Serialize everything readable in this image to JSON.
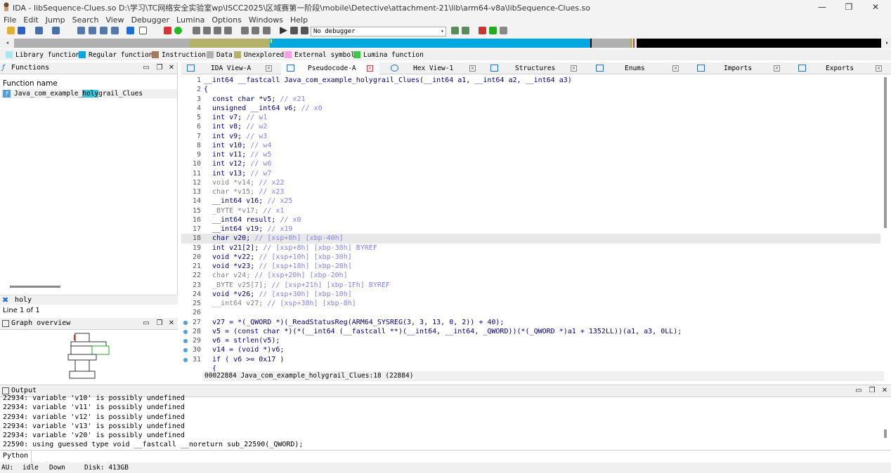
{
  "window": {
    "title": "IDA - libSequence-Clues.so D:\\学习\\TC网络安全实验室wp\\ISCC2025\\区域赛第一阶段\\mobile\\Detective\\attachment-21\\lib\\arm64-v8a\\libSequence-Clues.so",
    "minimize": "—",
    "maximize": "❐",
    "close": "✕"
  },
  "menu": [
    "File",
    "Edit",
    "Jump",
    "Search",
    "View",
    "Debugger",
    "Lumina",
    "Options",
    "Windows",
    "Help"
  ],
  "toolbar": {
    "debugger_select": "No debugger"
  },
  "legend": [
    {
      "label": "Library function",
      "color": "#a8e6f0"
    },
    {
      "label": "Regular function",
      "color": "#00a8e0"
    },
    {
      "label": "Instruction",
      "color": "#a67b5b"
    },
    {
      "label": "Data",
      "color": "#b0b0b0"
    },
    {
      "label": "Unexplored",
      "color": "#b5b06a"
    },
    {
      "label": "External symbol",
      "color": "#ff9ee6"
    },
    {
      "label": "Lumina function",
      "color": "#3cc84a"
    }
  ],
  "functions_panel": {
    "title": "Functions",
    "column_header": "Function name",
    "function_prefix": "Java_com_example_",
    "function_match": "holy",
    "function_suffix": "grail_Clues",
    "filter_text": "holy",
    "line_count": "Line 1 of 1"
  },
  "graph_panel": {
    "title": "Graph overview"
  },
  "tabs": [
    {
      "label": "IDA View-A"
    },
    {
      "label": "Pseudocode-A"
    },
    {
      "label": "Hex View-1"
    },
    {
      "label": "Structures"
    },
    {
      "label": "Enums"
    },
    {
      "label": "Imports"
    },
    {
      "label": "Exports"
    }
  ],
  "code_lines": [
    {
      "n": "1",
      "t": "__int64 __fastcall Java_com_example_holygrail_Clues(__int64 a1, __int64 a2, __int64 a3)"
    },
    {
      "n": "2",
      "t": "{"
    },
    {
      "n": "3",
      "t": "  const char *v5; // x21"
    },
    {
      "n": "4",
      "t": "  unsigned __int64 v6; // x0"
    },
    {
      "n": "5",
      "t": "  int v7; // w1"
    },
    {
      "n": "6",
      "t": "  int v8; // w2"
    },
    {
      "n": "7",
      "t": "  int v9; // w3"
    },
    {
      "n": "8",
      "t": "  int v10; // w4"
    },
    {
      "n": "9",
      "t": "  int v11; // w5"
    },
    {
      "n": "10",
      "t": "  int v12; // w6"
    },
    {
      "n": "11",
      "t": "  int v13; // w7"
    },
    {
      "n": "12",
      "t": "  void *v14; // x22"
    },
    {
      "n": "13",
      "t": "  char *v15; // x23"
    },
    {
      "n": "14",
      "t": "  __int64 v16; // x25"
    },
    {
      "n": "15",
      "t": "  _BYTE *v17; // x1"
    },
    {
      "n": "16",
      "t": "  __int64 result; // x0"
    },
    {
      "n": "17",
      "t": "  __int64 v19; // x19"
    },
    {
      "n": "18",
      "t": "  char v20; // [xsp+0h] [xbp-40h]"
    },
    {
      "n": "19",
      "t": "  int v21[2]; // [xsp+8h] [xbp-38h] BYREF"
    },
    {
      "n": "20",
      "t": "  void *v22; // [xsp+10h] [xbp-30h]"
    },
    {
      "n": "21",
      "t": "  void *v23; // [xsp+18h] [xbp-28h]"
    },
    {
      "n": "22",
      "t": "  char v24; // [xsp+20h] [xbp-20h]"
    },
    {
      "n": "23",
      "t": "  _BYTE v25[7]; // [xsp+21h] [xbp-1Fh] BYREF"
    },
    {
      "n": "24",
      "t": "  void *v26; // [xsp+30h] [xbp-10h]"
    },
    {
      "n": "25",
      "t": "  __int64 v27; // [xsp+38h] [xbp-8h]"
    },
    {
      "n": "26",
      "t": ""
    },
    {
      "n": "27",
      "t": "  v27 = *(_QWORD *)(_ReadStatusReg(ARM64_SYSREG(3, 3, 13, 0, 2)) + 40);"
    },
    {
      "n": "28",
      "t": "  v5 = (const char *)(*(__int64 (__fastcall **)(__int64, __int64, _QWORD))(*(_QWORD *)a1 + 1352LL))(a1, a3, 0LL);"
    },
    {
      "n": "29",
      "t": "  v6 = strlen(v5);"
    },
    {
      "n": "30",
      "t": "  v14 = (void *)v6;"
    },
    {
      "n": "31",
      "t": "  if ( v6 >= 0x17 )"
    },
    {
      "n": "",
      "t": "  {"
    }
  ],
  "code_status": "00022884 Java_com_example_holygrail_Clues:18 (22884)",
  "output_panel": {
    "title": "Output",
    "lines": [
      "22934: variable 'v10' is possibly undefined",
      "22934: variable 'v11' is possibly undefined",
      "22934: variable 'v12' is possibly undefined",
      "22934: variable 'v13' is possibly undefined",
      "22934: variable 'v20' is possibly undefined",
      "22590: using guessed type void __fastcall __noreturn sub_22590(_QWORD);"
    ]
  },
  "python_label": "Python",
  "statusbar": {
    "au_label": "AU:",
    "au_state": "idle",
    "direction": "Down",
    "disk": "Disk: 413GB"
  }
}
